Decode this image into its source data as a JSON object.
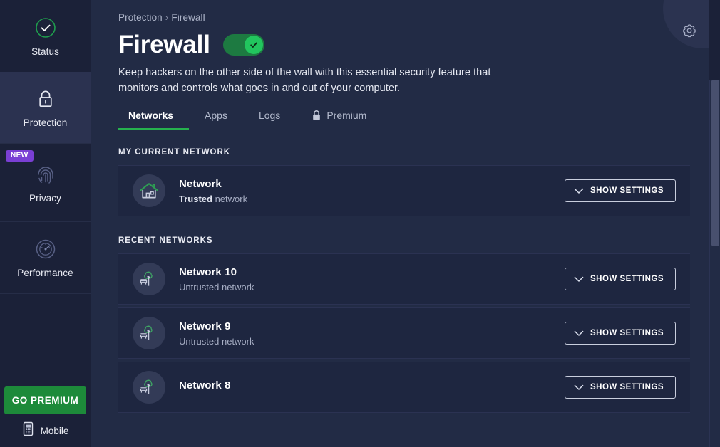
{
  "sidebar": {
    "items": [
      {
        "label": "Status",
        "icon": "check-circle-icon",
        "active": false,
        "badge": null
      },
      {
        "label": "Protection",
        "icon": "lock-icon",
        "active": true,
        "badge": null
      },
      {
        "label": "Privacy",
        "icon": "fingerprint-icon",
        "active": false,
        "badge": "NEW"
      },
      {
        "label": "Performance",
        "icon": "speedometer-icon",
        "active": false,
        "badge": null
      }
    ],
    "go_premium_label": "GO PREMIUM",
    "mobile_label": "Mobile"
  },
  "header": {
    "breadcrumb": {
      "parent": "Protection",
      "separator": "›",
      "current": "Firewall"
    },
    "title": "Firewall",
    "toggle": {
      "state": "on",
      "icon": "check-icon"
    },
    "description": "Keep hackers on the other side of the wall with this essential security feature that monitors and controls what goes in and out of your computer.",
    "settings_icon": "gear-icon"
  },
  "tabs": [
    {
      "label": "Networks",
      "active": true,
      "icon": null
    },
    {
      "label": "Apps",
      "active": false,
      "icon": null
    },
    {
      "label": "Logs",
      "active": false,
      "icon": null
    },
    {
      "label": "Premium",
      "active": false,
      "icon": "lock-icon"
    }
  ],
  "sections": [
    {
      "heading": "MY CURRENT NETWORK",
      "rows": [
        {
          "name": "Network",
          "status_strong": "Trusted",
          "status_rest": " network",
          "icon": "house-icon",
          "button_label": "SHOW SETTINGS",
          "button_icon": "chevron-down-icon"
        }
      ]
    },
    {
      "heading": "RECENT NETWORKS",
      "rows": [
        {
          "name": "Network 10",
          "status_strong": "",
          "status_rest": "Untrusted network",
          "icon": "park-tree-icon",
          "button_label": "SHOW SETTINGS",
          "button_icon": "chevron-down-icon"
        },
        {
          "name": "Network 9",
          "status_strong": "",
          "status_rest": "Untrusted network",
          "icon": "park-tree-icon",
          "button_label": "SHOW SETTINGS",
          "button_icon": "chevron-down-icon"
        },
        {
          "name": "Network 8",
          "status_strong": "",
          "status_rest": "",
          "icon": "park-tree-icon",
          "button_label": "SHOW SETTINGS",
          "button_icon": "chevron-down-icon"
        }
      ]
    }
  ],
  "colors": {
    "accent_green": "#26b14e",
    "toggle_knob": "#22c55e",
    "premium_green": "#1d8a3a",
    "badge_purple": "#7a3fd4",
    "sidebar_bg": "#1b2138",
    "main_bg": "#222b45",
    "card_bg": "#1e2640"
  }
}
